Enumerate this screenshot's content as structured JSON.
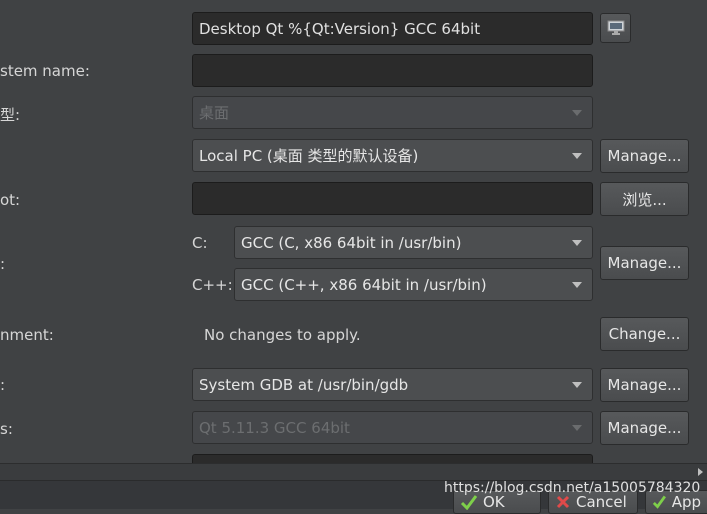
{
  "form": {
    "name_value": "Desktop Qt %{Qt:Version} GCC 64bit",
    "sysname_label": "stem name:",
    "devtype_label": "型:",
    "devtype_value": "桌面",
    "device_value": "Local PC (桌面 类型的默认设备)",
    "device_manage": "Manage...",
    "sysroot_label": "ot:",
    "sysroot_browse": "浏览...",
    "compiler_label": ":",
    "compiler_c_label": "C:",
    "compiler_c_value": "GCC (C, x86 64bit in /usr/bin)",
    "compiler_cpp_label": "C++:",
    "compiler_cpp_value": "GCC (C++, x86 64bit in /usr/bin)",
    "compiler_manage": "Manage...",
    "env_label": "nment:",
    "env_value": "No changes to apply.",
    "env_change": "Change...",
    "debugger_label": ":",
    "debugger_value": "System GDB at /usr/bin/gdb",
    "debugger_manage": "Manage...",
    "qtver_label": "s:",
    "qtver_value": "Qt 5.11.3 GCC 64bit",
    "qtver_manage": "Manage..."
  },
  "dialog": {
    "ok": "OK",
    "cancel": "Cancel",
    "apply": "App"
  },
  "watermark": "https://blog.csdn.net/a15005784320"
}
